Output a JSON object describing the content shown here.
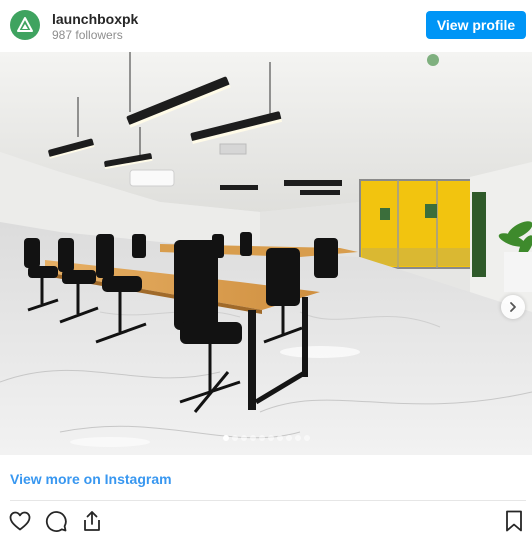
{
  "header": {
    "username": "launchboxpk",
    "followers": "987 followers",
    "view_profile_label": "View profile"
  },
  "post": {
    "photo_icon": "office-photo",
    "carousel_dots": 10,
    "active_dot": 0
  },
  "footer": {
    "view_more_label": "View more on Instagram"
  },
  "icons": {
    "like": "heart-icon",
    "comment": "comment-icon",
    "share": "share-icon",
    "save": "bookmark-icon",
    "next": "chevron-right-icon"
  },
  "colors": {
    "brand": "#0095f6",
    "link": "#3897f0",
    "avatar": "#3fa360",
    "accent_wall": "#f2c40f"
  }
}
